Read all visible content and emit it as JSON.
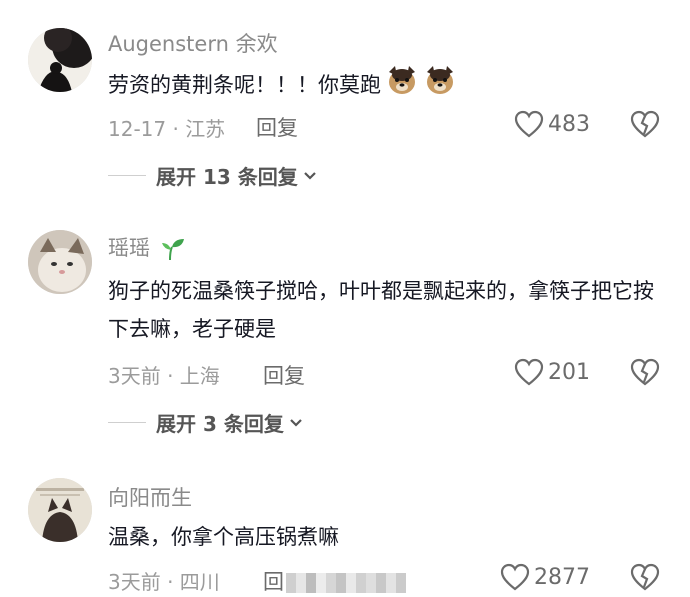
{
  "comments": [
    {
      "username": "Augenstern 余欢",
      "text": "劳资的黄荆条呢！！！你莫跑",
      "meta": "12-17 · 江苏",
      "reply_label": "回复",
      "likes": "483",
      "expand_label": "展开 13 条回复"
    },
    {
      "username": "瑶瑶",
      "text": "狗子的死温桑筷子搅哈，叶叶都是飘起来的，拿筷子把它按下去嘛，老子硬是",
      "meta": "3天前 · 上海",
      "reply_label": "回复",
      "likes": "201",
      "expand_label": "展开 3 条回复"
    },
    {
      "username": "向阳而生",
      "text": "温桑，你拿个高压锅煮嘛",
      "meta": "3天前 · 四川",
      "reply_label": "回",
      "likes": "2877"
    }
  ],
  "colors": {
    "text": "#161823",
    "meta": "#9b9b9b",
    "icon": "#6b6b6b",
    "sprout": "#3fa34d"
  },
  "icons": [
    "heart-outline-icon",
    "broken-heart-icon",
    "chevron-down-icon",
    "sprout-icon",
    "dog-emoji-icon"
  ]
}
